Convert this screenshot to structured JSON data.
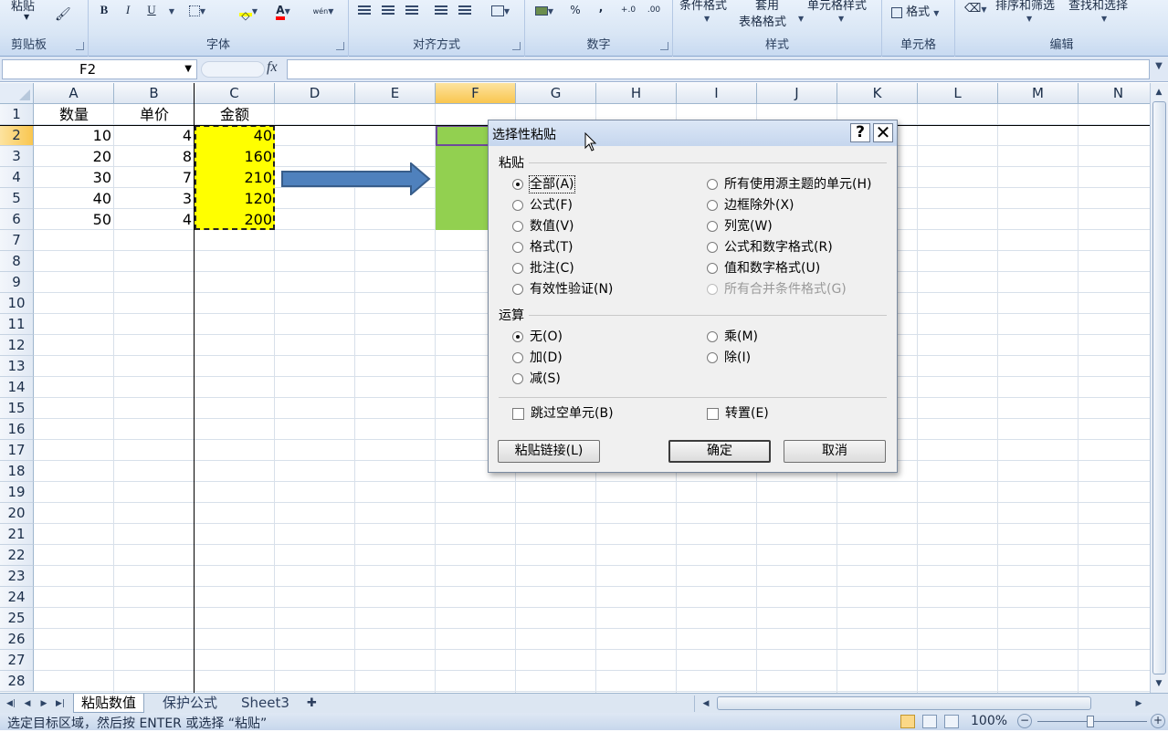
{
  "ribbon": {
    "clipboard": {
      "label": "剪贴板",
      "paste_label": "粘贴"
    },
    "font": {
      "label": "字体",
      "bold": "B",
      "italic": "I",
      "underline": "U",
      "font_color": "A",
      "phonetic": "wén"
    },
    "alignment": {
      "label": "对齐方式"
    },
    "number": {
      "label": "数字",
      "percent": "%",
      "comma": ",",
      "increase_decimal": "+.0",
      "decrease_decimal": ".00"
    },
    "styles": {
      "label": "样式",
      "conditional_format": "条件格式",
      "table_format_line1": "套用",
      "table_format_line2": "表格格式",
      "cell_styles": "单元格样式"
    },
    "cells": {
      "label": "单元格",
      "format": "格式"
    },
    "editing": {
      "label": "编辑",
      "sort_filter": "排序和筛选",
      "find_select": "查找和选择"
    }
  },
  "formula_bar": {
    "name_box": "F2",
    "fx": "fx",
    "value": ""
  },
  "sheet": {
    "columns": [
      "A",
      "B",
      "C",
      "D",
      "E",
      "F",
      "G",
      "H",
      "I",
      "J",
      "K",
      "L",
      "M",
      "N"
    ],
    "selected_column": "F",
    "rows": [
      "1",
      "2",
      "3",
      "4",
      "5",
      "6",
      "7",
      "8",
      "9",
      "10",
      "11",
      "12",
      "13",
      "14",
      "15",
      "16",
      "17",
      "18",
      "19",
      "20",
      "21",
      "22",
      "23",
      "24",
      "25",
      "26",
      "27",
      "28"
    ],
    "selected_row": "2",
    "headers": {
      "a": "数量",
      "b": "单价",
      "c": "金额"
    },
    "data": [
      {
        "qty": "10",
        "price": "4",
        "amount": "40"
      },
      {
        "qty": "20",
        "price": "8",
        "amount": "160"
      },
      {
        "qty": "30",
        "price": "7",
        "amount": "210"
      },
      {
        "qty": "40",
        "price": "3",
        "amount": "120"
      },
      {
        "qty": "50",
        "price": "4",
        "amount": "200"
      }
    ],
    "copy_fill_color": "#ffff00",
    "target_fill_color": "#92d050",
    "arrow_color": "#4f81bd"
  },
  "tabs": [
    "粘贴数值",
    "保护公式",
    "Sheet3"
  ],
  "active_tab": "粘贴数值",
  "status": {
    "message": "选定目标区域，然后按 ENTER 或选择 “粘贴”",
    "zoom": "100%"
  },
  "dialog": {
    "title": "选择性粘贴",
    "help": "?",
    "close": "✕",
    "paste_section": "粘贴",
    "paste_left": [
      "全部(A)",
      "公式(F)",
      "数值(V)",
      "格式(T)",
      "批注(C)",
      "有效性验证(N)"
    ],
    "paste_right": [
      "所有使用源主题的单元(H)",
      "边框除外(X)",
      "列宽(W)",
      "公式和数字格式(R)",
      "值和数字格式(U)",
      "所有合并条件格式(G)"
    ],
    "paste_selected": "全部(A)",
    "op_section": "运算",
    "op_left": [
      "无(O)",
      "加(D)",
      "减(S)"
    ],
    "op_right": [
      "乘(M)",
      "除(I)"
    ],
    "op_selected": "无(O)",
    "skip_blanks": "跳过空单元(B)",
    "transpose": "转置(E)",
    "paste_link": "粘贴链接(L)",
    "ok": "确定",
    "cancel": "取消"
  }
}
